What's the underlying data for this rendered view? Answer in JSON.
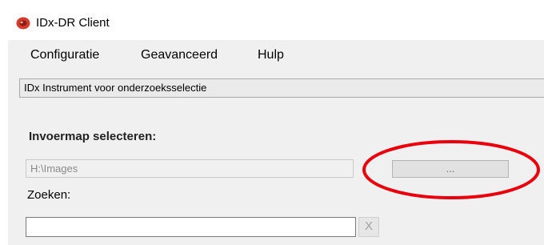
{
  "window": {
    "title": "IDx-DR Client",
    "icon": "app-logo-icon"
  },
  "menu": {
    "items": [
      {
        "label": "Configuratie"
      },
      {
        "label": "Geavanceerd"
      },
      {
        "label": "Hulp"
      }
    ]
  },
  "infobar": {
    "text": "IDx Instrument voor onderzoeksselectie"
  },
  "input_folder": {
    "label": "Invoermap selecteren:",
    "value": "H:\\Images",
    "browse_label": "..."
  },
  "search": {
    "label": "Zoeken:",
    "value": "",
    "clear_label": "X"
  },
  "colors": {
    "highlight": "#e8000d",
    "icon_red": "#d43a2b"
  }
}
